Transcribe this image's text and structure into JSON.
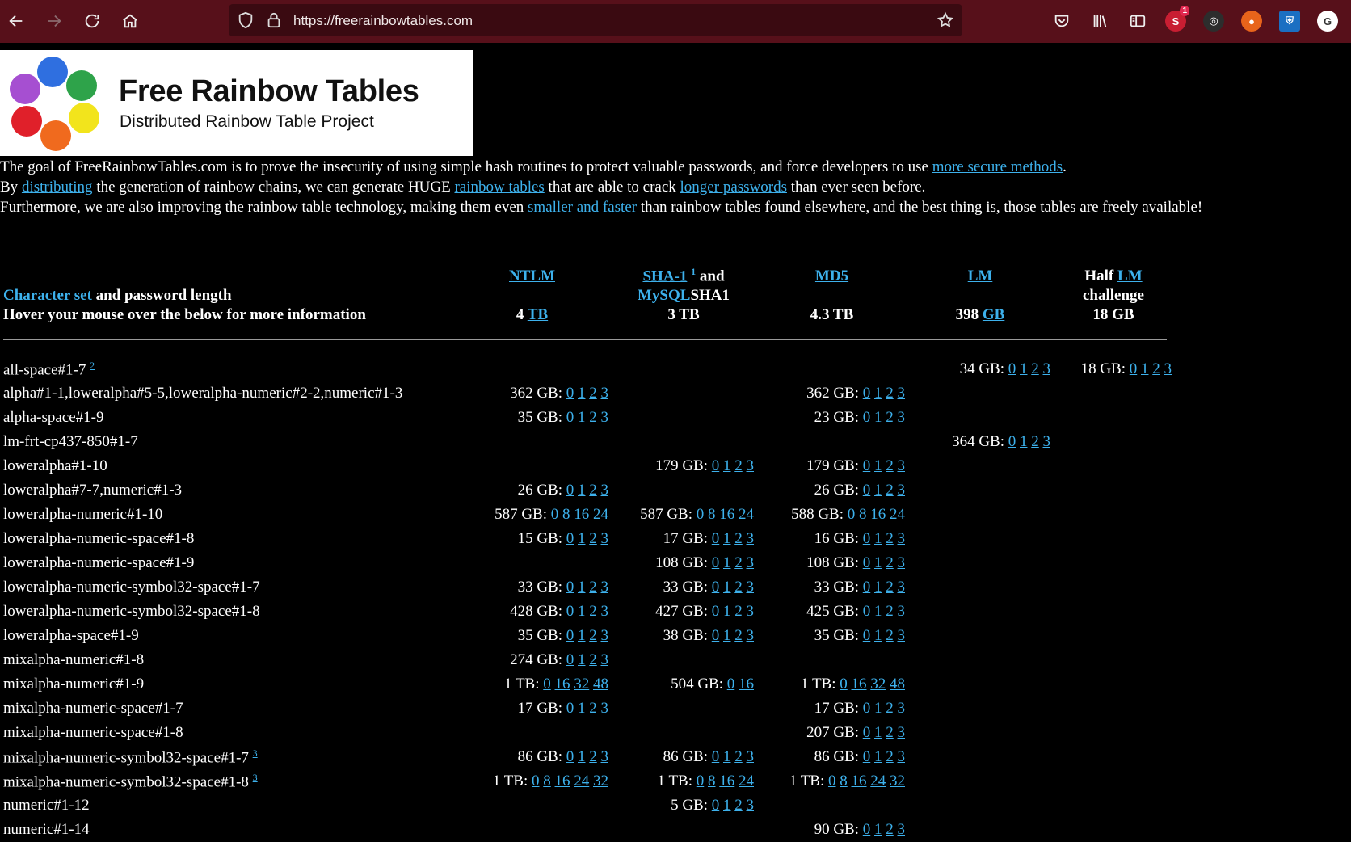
{
  "browser": {
    "url": "https://freerainbowtables.com",
    "extension_badge": "1",
    "account_initial": "G"
  },
  "logo": {
    "title": "Free Rainbow Tables",
    "subtitle": "Distributed Rainbow Table Project"
  },
  "intro": {
    "line1_pre": "The goal of FreeRainbowTables.com is to prove the insecurity of using simple hash routines to protect valuable passwords, and force developers to use ",
    "line1_link": "more secure methods",
    "line1_post": ".",
    "line2_a": "By ",
    "line2_link1": "distributing",
    "line2_b": " the generation of rainbow chains, we can generate HUGE ",
    "line2_link2": "rainbow tables",
    "line2_c": " that are able to crack ",
    "line2_link3": "longer passwords",
    "line2_d": " than ever seen before.",
    "line3_pre": "Furthermore, we are also improving the rainbow table technology, making them even ",
    "line3_link": "smaller and faster",
    "line3_post": " than rainbow tables found elsewhere, and the best thing is, those tables are freely available!"
  },
  "table_header": {
    "charset_link": "Character set",
    "charset_rest": " and password length",
    "hover_note": "Hover your mouse over the below for more information",
    "ntlm_link": "NTLM",
    "ntlm_size_num": "4 ",
    "ntlm_size_unit": "TB",
    "sha1_link": "SHA-1",
    "sha1_sup": "1",
    "sha1_and": " and",
    "mysql_link": "MySQL",
    "mysql_rest": "SHA1",
    "sha1_size": "3 TB",
    "md5_link": "MD5",
    "md5_size": "4.3 TB",
    "lm_link": "LM",
    "lm_size_num": "398 ",
    "lm_size_unit": "GB",
    "half_pre": "Half ",
    "half_link": "LM",
    "half_line2": "challenge",
    "half_size": "18 GB"
  },
  "rows": [
    {
      "name": "all-space#1-7",
      "sup": "2",
      "ntlm": null,
      "sha1": null,
      "md5": null,
      "lm": {
        "size": "34 GB:",
        "links": [
          "0",
          "1",
          "2",
          "3"
        ]
      },
      "half": {
        "size": "18 GB:",
        "links": [
          "0",
          "1",
          "2",
          "3"
        ]
      }
    },
    {
      "name": "alpha#1-1,loweralpha#5-5,loweralpha-numeric#2-2,numeric#1-3",
      "ntlm": {
        "size": "362 GB:",
        "links": [
          "0",
          "1",
          "2",
          "3"
        ]
      },
      "sha1": null,
      "md5": {
        "size": "362 GB:",
        "links": [
          "0",
          "1",
          "2",
          "3"
        ]
      },
      "lm": null,
      "half": null
    },
    {
      "name": "alpha-space#1-9",
      "ntlm": {
        "size": "35 GB:",
        "links": [
          "0",
          "1",
          "2",
          "3"
        ]
      },
      "sha1": null,
      "md5": {
        "size": "23 GB:",
        "links": [
          "0",
          "1",
          "2",
          "3"
        ]
      },
      "lm": null,
      "half": null
    },
    {
      "name": "lm-frt-cp437-850#1-7",
      "ntlm": null,
      "sha1": null,
      "md5": null,
      "lm": {
        "size": "364 GB:",
        "links": [
          "0",
          "1",
          "2",
          "3"
        ]
      },
      "half": null
    },
    {
      "name": "loweralpha#1-10",
      "ntlm": null,
      "sha1": {
        "size": "179 GB:",
        "links": [
          "0",
          "1",
          "2",
          "3"
        ]
      },
      "md5": {
        "size": "179 GB:",
        "links": [
          "0",
          "1",
          "2",
          "3"
        ]
      },
      "lm": null,
      "half": null
    },
    {
      "name": "loweralpha#7-7,numeric#1-3",
      "ntlm": {
        "size": "26 GB:",
        "links": [
          "0",
          "1",
          "2",
          "3"
        ]
      },
      "sha1": null,
      "md5": {
        "size": "26 GB:",
        "links": [
          "0",
          "1",
          "2",
          "3"
        ]
      },
      "lm": null,
      "half": null
    },
    {
      "name": "loweralpha-numeric#1-10",
      "ntlm": {
        "size": "587 GB:",
        "links": [
          "0",
          "8",
          "16",
          "24"
        ]
      },
      "sha1": {
        "size": "587 GB:",
        "links": [
          "0",
          "8",
          "16",
          "24"
        ]
      },
      "md5": {
        "size": "588 GB:",
        "links": [
          "0",
          "8",
          "16",
          "24"
        ]
      },
      "lm": null,
      "half": null
    },
    {
      "name": "loweralpha-numeric-space#1-8",
      "ntlm": {
        "size": "15 GB:",
        "links": [
          "0",
          "1",
          "2",
          "3"
        ]
      },
      "sha1": {
        "size": "17 GB:",
        "links": [
          "0",
          "1",
          "2",
          "3"
        ]
      },
      "md5": {
        "size": "16 GB:",
        "links": [
          "0",
          "1",
          "2",
          "3"
        ]
      },
      "lm": null,
      "half": null
    },
    {
      "name": "loweralpha-numeric-space#1-9",
      "ntlm": null,
      "sha1": {
        "size": "108 GB:",
        "links": [
          "0",
          "1",
          "2",
          "3"
        ]
      },
      "md5": {
        "size": "108 GB:",
        "links": [
          "0",
          "1",
          "2",
          "3"
        ]
      },
      "lm": null,
      "half": null
    },
    {
      "name": "loweralpha-numeric-symbol32-space#1-7",
      "ntlm": {
        "size": "33 GB:",
        "links": [
          "0",
          "1",
          "2",
          "3"
        ]
      },
      "sha1": {
        "size": "33 GB:",
        "links": [
          "0",
          "1",
          "2",
          "3"
        ]
      },
      "md5": {
        "size": "33 GB:",
        "links": [
          "0",
          "1",
          "2",
          "3"
        ]
      },
      "lm": null,
      "half": null
    },
    {
      "name": "loweralpha-numeric-symbol32-space#1-8",
      "ntlm": {
        "size": "428 GB:",
        "links": [
          "0",
          "1",
          "2",
          "3"
        ]
      },
      "sha1": {
        "size": "427 GB:",
        "links": [
          "0",
          "1",
          "2",
          "3"
        ]
      },
      "md5": {
        "size": "425 GB:",
        "links": [
          "0",
          "1",
          "2",
          "3"
        ]
      },
      "lm": null,
      "half": null
    },
    {
      "name": "loweralpha-space#1-9",
      "ntlm": {
        "size": "35 GB:",
        "links": [
          "0",
          "1",
          "2",
          "3"
        ]
      },
      "sha1": {
        "size": "38 GB:",
        "links": [
          "0",
          "1",
          "2",
          "3"
        ]
      },
      "md5": {
        "size": "35 GB:",
        "links": [
          "0",
          "1",
          "2",
          "3"
        ]
      },
      "lm": null,
      "half": null
    },
    {
      "name": "mixalpha-numeric#1-8",
      "ntlm": {
        "size": "274 GB:",
        "links": [
          "0",
          "1",
          "2",
          "3"
        ]
      },
      "sha1": null,
      "md5": null,
      "lm": null,
      "half": null
    },
    {
      "name": "mixalpha-numeric#1-9",
      "ntlm": {
        "size": "1 TB:",
        "links": [
          "0",
          "16",
          "32",
          "48"
        ]
      },
      "sha1": {
        "size": "504 GB:",
        "links": [
          "0",
          "16"
        ]
      },
      "md5": {
        "size": "1 TB:",
        "links": [
          "0",
          "16",
          "32",
          "48"
        ]
      },
      "lm": null,
      "half": null
    },
    {
      "name": "mixalpha-numeric-space#1-7",
      "ntlm": {
        "size": "17 GB:",
        "links": [
          "0",
          "1",
          "2",
          "3"
        ]
      },
      "sha1": null,
      "md5": {
        "size": "17 GB:",
        "links": [
          "0",
          "1",
          "2",
          "3"
        ]
      },
      "lm": null,
      "half": null
    },
    {
      "name": "mixalpha-numeric-space#1-8",
      "ntlm": null,
      "sha1": null,
      "md5": {
        "size": "207 GB:",
        "links": [
          "0",
          "1",
          "2",
          "3"
        ]
      },
      "lm": null,
      "half": null
    },
    {
      "name": "mixalpha-numeric-symbol32-space#1-7",
      "sup": "3",
      "ntlm": {
        "size": "86 GB:",
        "links": [
          "0",
          "1",
          "2",
          "3"
        ]
      },
      "sha1": {
        "size": "86 GB:",
        "links": [
          "0",
          "1",
          "2",
          "3"
        ]
      },
      "md5": {
        "size": "86 GB:",
        "links": [
          "0",
          "1",
          "2",
          "3"
        ]
      },
      "lm": null,
      "half": null
    },
    {
      "name": "mixalpha-numeric-symbol32-space#1-8",
      "sup": "3",
      "ntlm": {
        "size": "1 TB:",
        "links": [
          "0",
          "8",
          "16",
          "24",
          "32"
        ]
      },
      "sha1": {
        "size": "1 TB:",
        "links": [
          "0",
          "8",
          "16",
          "24"
        ]
      },
      "md5": {
        "size": "1 TB:",
        "links": [
          "0",
          "8",
          "16",
          "24",
          "32"
        ]
      },
      "lm": null,
      "half": null
    },
    {
      "name": "numeric#1-12",
      "ntlm": null,
      "sha1": {
        "size": "5 GB:",
        "links": [
          "0",
          "1",
          "2",
          "3"
        ]
      },
      "md5": null,
      "lm": null,
      "half": null
    },
    {
      "name": "numeric#1-14",
      "ntlm": null,
      "sha1": null,
      "md5": {
        "size": "90 GB:",
        "links": [
          "0",
          "1",
          "2",
          "3"
        ]
      },
      "lm": null,
      "half": null
    }
  ]
}
